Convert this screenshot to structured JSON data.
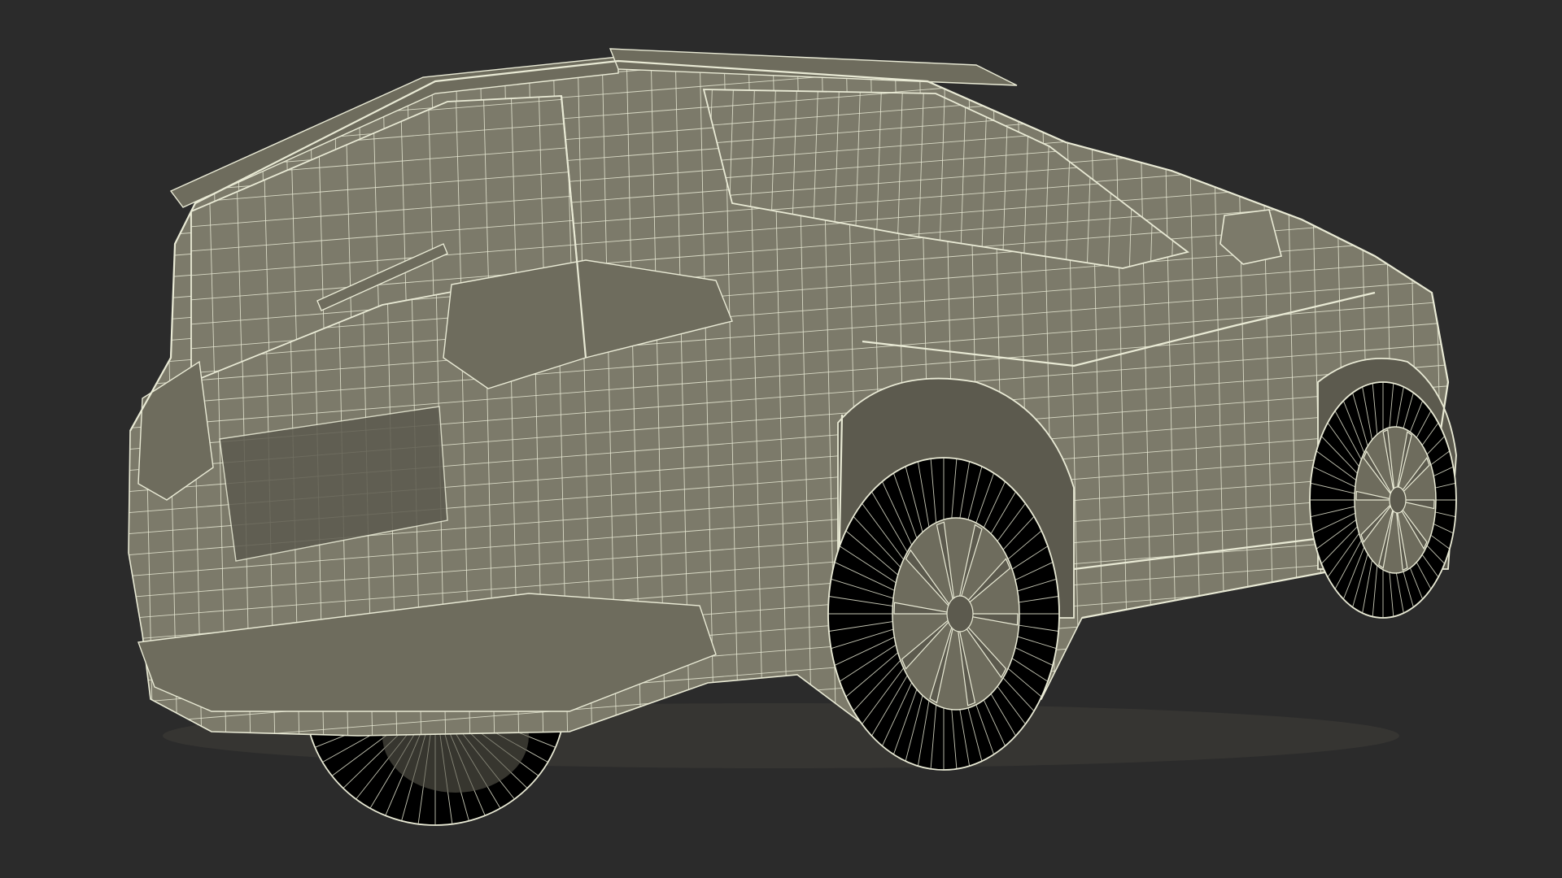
{
  "scene": {
    "subject": "suv-wireframe",
    "view": "rear-three-quarter",
    "colors": {
      "background": "#2b2b2b",
      "body_fill": "#7c7a6a",
      "body_shade": "#6e6c5d",
      "body_dark": "#5c5a4e",
      "tire_fill": "#707060",
      "wire": "#e9ead5",
      "shadow": "#4a493f"
    }
  }
}
